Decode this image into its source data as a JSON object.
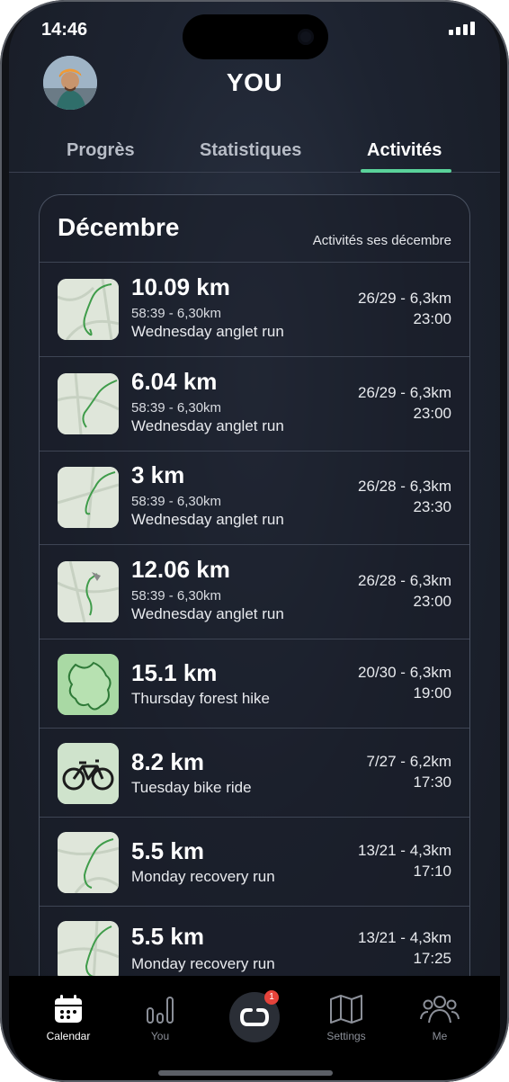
{
  "status_bar": {
    "time": "14:46"
  },
  "header": {
    "title": "YOU"
  },
  "tabs": [
    {
      "label": "Progrès",
      "active": false
    },
    {
      "label": "Statistiques",
      "active": false
    },
    {
      "label": "Activités",
      "active": true
    }
  ],
  "card": {
    "title": "Décembre",
    "subtitle": "Activités ses décembre",
    "activities": [
      {
        "distance": "10.09 km",
        "meta": "58:39 - 6,30km",
        "name": "Wednesday anglet run",
        "stat": "26/29 - 6,3km",
        "time": "23:00",
        "thumb": "route-map"
      },
      {
        "distance": "6.04 km",
        "meta": "58:39 - 6,30km",
        "name": "Wednesday anglet run",
        "stat": "26/29 - 6,3km",
        "time": "23:00",
        "thumb": "route-map"
      },
      {
        "distance": "3 km",
        "meta": "58:39 - 6,30km",
        "name": "Wednesday anglet run",
        "stat": "26/28 - 6,3km",
        "time": "23:30",
        "thumb": "route-map"
      },
      {
        "distance": "12.06 km",
        "meta": "58:39 - 6,30km",
        "name": "Wednesday anglet run",
        "stat": "26/28 - 6,3km",
        "time": "23:00",
        "thumb": "route-map"
      },
      {
        "distance": "15.1 km",
        "meta": "",
        "name": "Thursday forest hike",
        "stat": "20/30 - 6,3km",
        "time": "19:00",
        "thumb": "forest-map"
      },
      {
        "distance": "8.2 km",
        "meta": "",
        "name": "Tuesday bike ride",
        "stat": "7/27 - 6,2km",
        "time": "17:30",
        "thumb": "bike-icon"
      },
      {
        "distance": "5.5 km",
        "meta": "",
        "name": "Monday recovery run",
        "stat": "13/21 - 4,3km",
        "time": "17:10",
        "thumb": "route-map"
      },
      {
        "distance": "5.5 km",
        "meta": "",
        "name": "Monday recovery run",
        "stat": "13/21 - 4,3km",
        "time": "17:25",
        "thumb": "route-map"
      }
    ]
  },
  "bottom_nav": {
    "items": [
      {
        "label": "Calendar",
        "icon": "calendar-icon",
        "active": true
      },
      {
        "label": "You",
        "icon": "bar-chart-icon",
        "active": false
      },
      {
        "label": "Settings",
        "icon": "map-icon",
        "active": false
      },
      {
        "label": "Me",
        "icon": "people-icon",
        "active": false
      }
    ],
    "center_badge": "1"
  },
  "colors": {
    "accent": "#5ad29a",
    "background": "#1d2330",
    "badge": "#e5433b"
  }
}
